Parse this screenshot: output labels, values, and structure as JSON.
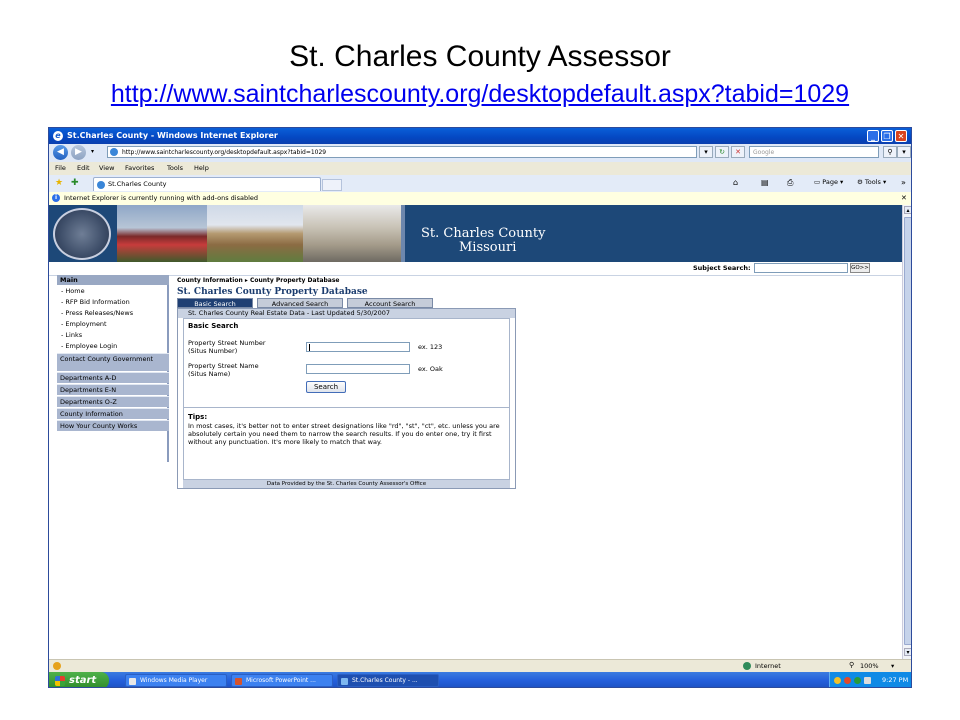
{
  "slide": {
    "title": "St. Charles County Assessor",
    "link": "http://www.saintcharlescounty.org/desktopdefault.aspx?tabid=1029"
  },
  "window": {
    "title": "St.Charles County - Windows Internet Explorer",
    "address": "http://www.saintcharlescounty.org/desktopdefault.aspx?tabid=1029",
    "search_placeholder": "Google"
  },
  "menu": [
    "File",
    "Edit",
    "View",
    "Favorites",
    "Tools",
    "Help"
  ],
  "tab": {
    "label": "St.Charles County"
  },
  "toolbar": {
    "page": "Page",
    "tools": "Tools"
  },
  "infobar": {
    "text": "Internet Explorer is currently running with add-ons disabled"
  },
  "site": {
    "banner_line1": "St. Charles County",
    "banner_line2": "Missouri",
    "subject_search_label": "Subject Search:",
    "go_label": "GO>>"
  },
  "sidebar": {
    "main_label": "Main",
    "items": [
      "- Home",
      "- RFP Bid Information",
      "- Press Releases/News",
      "- Employment",
      "- Links",
      "- Employee Login"
    ],
    "departments": [
      "Contact County Government",
      "Departments A-D",
      "Departments E-N",
      "Departments O-Z",
      "County Information",
      "How Your County Works"
    ]
  },
  "breadcrumb": "County Information ▸ County Property Database",
  "db": {
    "title": "St. Charles County Property Database",
    "tabs": [
      "Basic Search",
      "Advanced Search",
      "Account Search"
    ],
    "panel_header": "St. Charles County Real Estate Data - Last Updated  5/30/2007",
    "basic_search_label": "Basic Search",
    "field1_label_line1": "Property Street Number",
    "field1_label_line2": "(Situs Number)",
    "field1_example": "ex. 123",
    "field2_label_line1": "Property Street Name",
    "field2_label_line2": "(Situs Name)",
    "field2_example": "ex. Oak",
    "search_button": "Search",
    "tips_label": "Tips:",
    "tips_text": "In most cases, it's better not to enter street designations like \"rd\", \"st\", \"ct\", etc. unless you are absolutely certain you need them to narrow the search results. If you do enter one, try it first without any punctuation. It's more likely to match that way.",
    "footer": "Data Provided by the St. Charles County Assessor's Office"
  },
  "status": {
    "zone": "Internet",
    "zoom": "100%"
  },
  "taskbar": {
    "start": "start",
    "buttons": [
      "Windows Media Player",
      "Microsoft PowerPoint ...",
      "St.Charles County - ..."
    ],
    "clock": "9:27 PM"
  }
}
